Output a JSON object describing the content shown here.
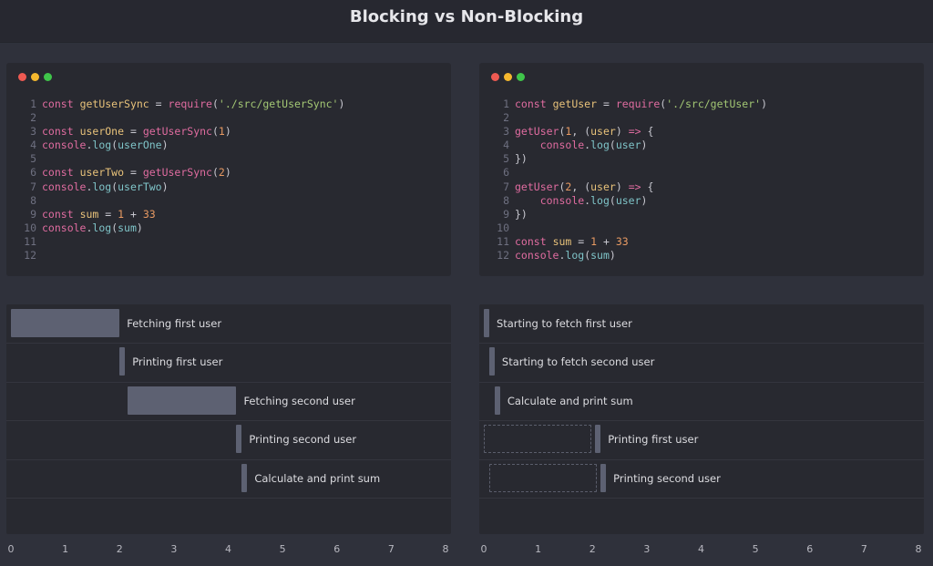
{
  "title": "Blocking vs Non-Blocking",
  "colors": {
    "background": "#2f313b",
    "panel": "#282930",
    "bar": "#5d6172",
    "dot_red": "#ee5a52",
    "dot_yellow": "#f5b82e",
    "dot_green": "#3fc54a"
  },
  "windows": [
    {
      "lines": [
        [
          [
            "kw",
            "const"
          ],
          [
            "p",
            " "
          ],
          [
            "fn",
            "getUserSync"
          ],
          [
            "p",
            " = "
          ],
          [
            "kw",
            "require"
          ],
          [
            "p",
            "("
          ],
          [
            "str",
            "'./src/getUserSync'"
          ],
          [
            "p",
            ")"
          ]
        ],
        [],
        [
          [
            "kw",
            "const"
          ],
          [
            "p",
            " "
          ],
          [
            "fn",
            "userOne"
          ],
          [
            "p",
            " = "
          ],
          [
            "kw",
            "getUserSync"
          ],
          [
            "p",
            "("
          ],
          [
            "num",
            "1"
          ],
          [
            "p",
            ")"
          ]
        ],
        [
          [
            "kw",
            "console"
          ],
          [
            "p",
            "."
          ],
          [
            "prop",
            "log"
          ],
          [
            "p",
            "("
          ],
          [
            "prop",
            "userOne"
          ],
          [
            "p",
            ")"
          ]
        ],
        [],
        [
          [
            "kw",
            "const"
          ],
          [
            "p",
            " "
          ],
          [
            "fn",
            "userTwo"
          ],
          [
            "p",
            " = "
          ],
          [
            "kw",
            "getUserSync"
          ],
          [
            "p",
            "("
          ],
          [
            "num",
            "2"
          ],
          [
            "p",
            ")"
          ]
        ],
        [
          [
            "kw",
            "console"
          ],
          [
            "p",
            "."
          ],
          [
            "prop",
            "log"
          ],
          [
            "p",
            "("
          ],
          [
            "prop",
            "userTwo"
          ],
          [
            "p",
            ")"
          ]
        ],
        [],
        [
          [
            "kw",
            "const"
          ],
          [
            "p",
            " "
          ],
          [
            "fn",
            "sum"
          ],
          [
            "p",
            " = "
          ],
          [
            "num",
            "1"
          ],
          [
            "p",
            " + "
          ],
          [
            "num",
            "33"
          ]
        ],
        [
          [
            "kw",
            "console"
          ],
          [
            "p",
            "."
          ],
          [
            "prop",
            "log"
          ],
          [
            "p",
            "("
          ],
          [
            "prop",
            "sum"
          ],
          [
            "p",
            ")"
          ]
        ],
        [],
        []
      ]
    },
    {
      "lines": [
        [
          [
            "kw",
            "const"
          ],
          [
            "p",
            " "
          ],
          [
            "fn",
            "getUser"
          ],
          [
            "p",
            " = "
          ],
          [
            "kw",
            "require"
          ],
          [
            "p",
            "("
          ],
          [
            "str",
            "'./src/getUser'"
          ],
          [
            "p",
            ")"
          ]
        ],
        [],
        [
          [
            "kw",
            "getUser"
          ],
          [
            "p",
            "("
          ],
          [
            "num",
            "1"
          ],
          [
            "p",
            ", ("
          ],
          [
            "fn",
            "user"
          ],
          [
            "p",
            ") "
          ],
          [
            "kw",
            "=>"
          ],
          [
            "p",
            " {"
          ]
        ],
        [
          [
            "p",
            "    "
          ],
          [
            "kw",
            "console"
          ],
          [
            "p",
            "."
          ],
          [
            "prop",
            "log"
          ],
          [
            "p",
            "("
          ],
          [
            "prop",
            "user"
          ],
          [
            "p",
            ")"
          ]
        ],
        [
          [
            "p",
            "})"
          ]
        ],
        [],
        [
          [
            "kw",
            "getUser"
          ],
          [
            "p",
            "("
          ],
          [
            "num",
            "2"
          ],
          [
            "p",
            ", ("
          ],
          [
            "fn",
            "user"
          ],
          [
            "p",
            ") "
          ],
          [
            "kw",
            "=>"
          ],
          [
            "p",
            " {"
          ]
        ],
        [
          [
            "p",
            "    "
          ],
          [
            "kw",
            "console"
          ],
          [
            "p",
            "."
          ],
          [
            "prop",
            "log"
          ],
          [
            "p",
            "("
          ],
          [
            "prop",
            "user"
          ],
          [
            "p",
            ")"
          ]
        ],
        [
          [
            "p",
            "})"
          ]
        ],
        [],
        [
          [
            "kw",
            "const"
          ],
          [
            "p",
            " "
          ],
          [
            "fn",
            "sum"
          ],
          [
            "p",
            " = "
          ],
          [
            "num",
            "1"
          ],
          [
            "p",
            " + "
          ],
          [
            "num",
            "33"
          ]
        ],
        [
          [
            "kw",
            "console"
          ],
          [
            "p",
            "."
          ],
          [
            "prop",
            "log"
          ],
          [
            "p",
            "("
          ],
          [
            "prop",
            "sum"
          ],
          [
            "p",
            ")"
          ]
        ]
      ]
    }
  ],
  "chart_data": [
    {
      "type": "bar",
      "xlim": [
        0,
        8
      ],
      "ticks": [
        "0",
        "1",
        "2",
        "3",
        "4",
        "5",
        "6",
        "7",
        "8"
      ],
      "tasks": [
        {
          "label": "Fetching first user",
          "start": 0,
          "end": 2.0
        },
        {
          "label": "Printing first user",
          "start": 2.0,
          "end": 2.1
        },
        {
          "label": "Fetching second user",
          "start": 2.15,
          "end": 4.15
        },
        {
          "label": "Printing second user",
          "start": 4.15,
          "end": 4.25
        },
        {
          "label": "Calculate and print sum",
          "start": 4.25,
          "end": 4.35
        }
      ]
    },
    {
      "type": "bar",
      "xlim": [
        0,
        8
      ],
      "ticks": [
        "0",
        "1",
        "2",
        "3",
        "4",
        "5",
        "6",
        "7",
        "8"
      ],
      "tasks": [
        {
          "label": "Starting to fetch first user",
          "start": 0,
          "end": 0.1
        },
        {
          "label": "Starting to fetch second user",
          "start": 0.1,
          "end": 0.2
        },
        {
          "label": "Calculate and print sum",
          "start": 0.2,
          "end": 0.3
        },
        {
          "label": "Printing first user",
          "start": 2.05,
          "end": 2.15,
          "waiting_from": 0
        },
        {
          "label": "Printing second user",
          "start": 2.15,
          "end": 2.25,
          "waiting_from": 0.1
        }
      ]
    }
  ]
}
